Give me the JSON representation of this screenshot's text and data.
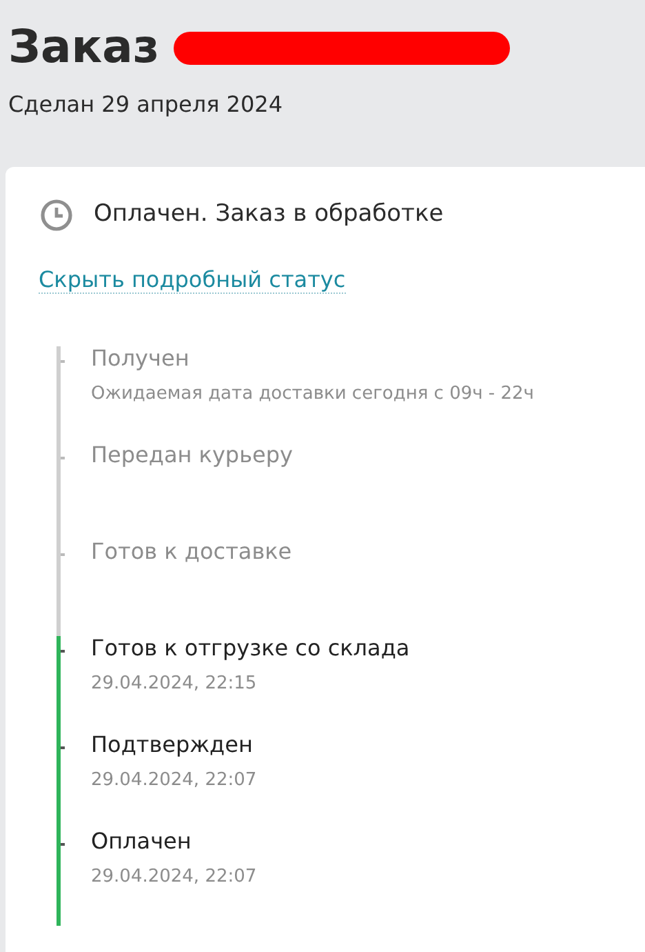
{
  "header": {
    "title": "Заказ",
    "subtitle": "Сделан 29 апреля 2024"
  },
  "status": {
    "text": "Оплачен. Заказ в обработке",
    "toggle_link": "Скрыть подробный статус"
  },
  "timeline": [
    {
      "title": "Получен",
      "detail": "Ожидаемая дата доставки сегодня с 09ч - 22ч",
      "done": false
    },
    {
      "title": "Передан курьеру",
      "done": false
    },
    {
      "title": "Готов к доставке",
      "done": false
    },
    {
      "title": "Готов к отгрузке со склада",
      "detail": "29.04.2024, 22:15",
      "done": true
    },
    {
      "title": "Подтвержден",
      "detail": "29.04.2024, 22:07",
      "done": true
    },
    {
      "title": "Оплачен",
      "detail": "29.04.2024, 22:07",
      "done": true
    }
  ]
}
